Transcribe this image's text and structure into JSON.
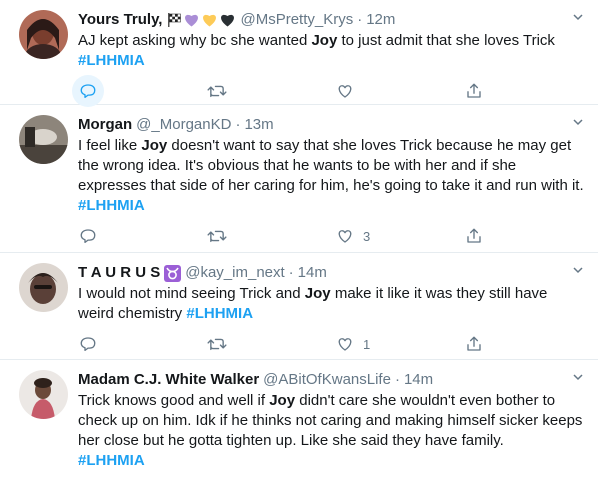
{
  "tweets": [
    {
      "name": "Yours Truly,",
      "handle": "@MsPretty_Krys",
      "time": "12m",
      "text_a": "AJ kept asking why bc she wanted ",
      "highlight": "Joy",
      "text_b": " to just admit that she loves Trick",
      "text_c": "",
      "hashtag": "#LHHMIA",
      "likes": "",
      "reply_active": true,
      "avatar_bg": "#8a4b3e"
    },
    {
      "name": "Morgan",
      "handle": "@_MorganKD",
      "time": "13m",
      "text_a": "I feel like ",
      "highlight": "Joy",
      "text_b": " doesn't want to say that she loves Trick because he may get the wrong idea. It's obvious that he wants to be with her and if she expresses that side of her caring for him, he's going to take it and run with it. ",
      "text_c": "",
      "hashtag": "#LHHMIA",
      "likes": "3",
      "reply_active": false,
      "avatar_bg": "#5b5349"
    },
    {
      "name": "T A U R U S",
      "handle": "@kay_im_next",
      "time": "14m",
      "text_a": "I would not mind seeing Trick and ",
      "highlight": "Joy",
      "text_b": " make it like it was they still have weird chemistry ",
      "text_c": "",
      "hashtag": "#LHHMIA",
      "likes": "1",
      "reply_active": false,
      "avatar_bg": "#6b5a4f"
    },
    {
      "name": "Madam C.J. White Walker",
      "handle": "@ABitOfKwansLife",
      "time": "14m",
      "text_a": "Trick knows good and well if ",
      "highlight": "Joy",
      "text_b": " didn't care she wouldn't even bother to check up on him. Idk if he thinks not caring and making himself sicker keeps her close but he gotta tighten up. Like she said they have family.",
      "text_c": "",
      "hashtag": "#LHHMIA",
      "likes": "",
      "reply_active": false,
      "avatar_bg": "#c9c2bd"
    }
  ],
  "emoji": {
    "tweet0": [
      "checkered-flag",
      "purple-heart",
      "yellow-heart",
      "black-heart"
    ],
    "tweet2": "taurus-sign"
  },
  "colors": {
    "accent": "#1da1f2",
    "muted": "#657786",
    "text": "#14171a",
    "divider": "#e6ecf0"
  }
}
